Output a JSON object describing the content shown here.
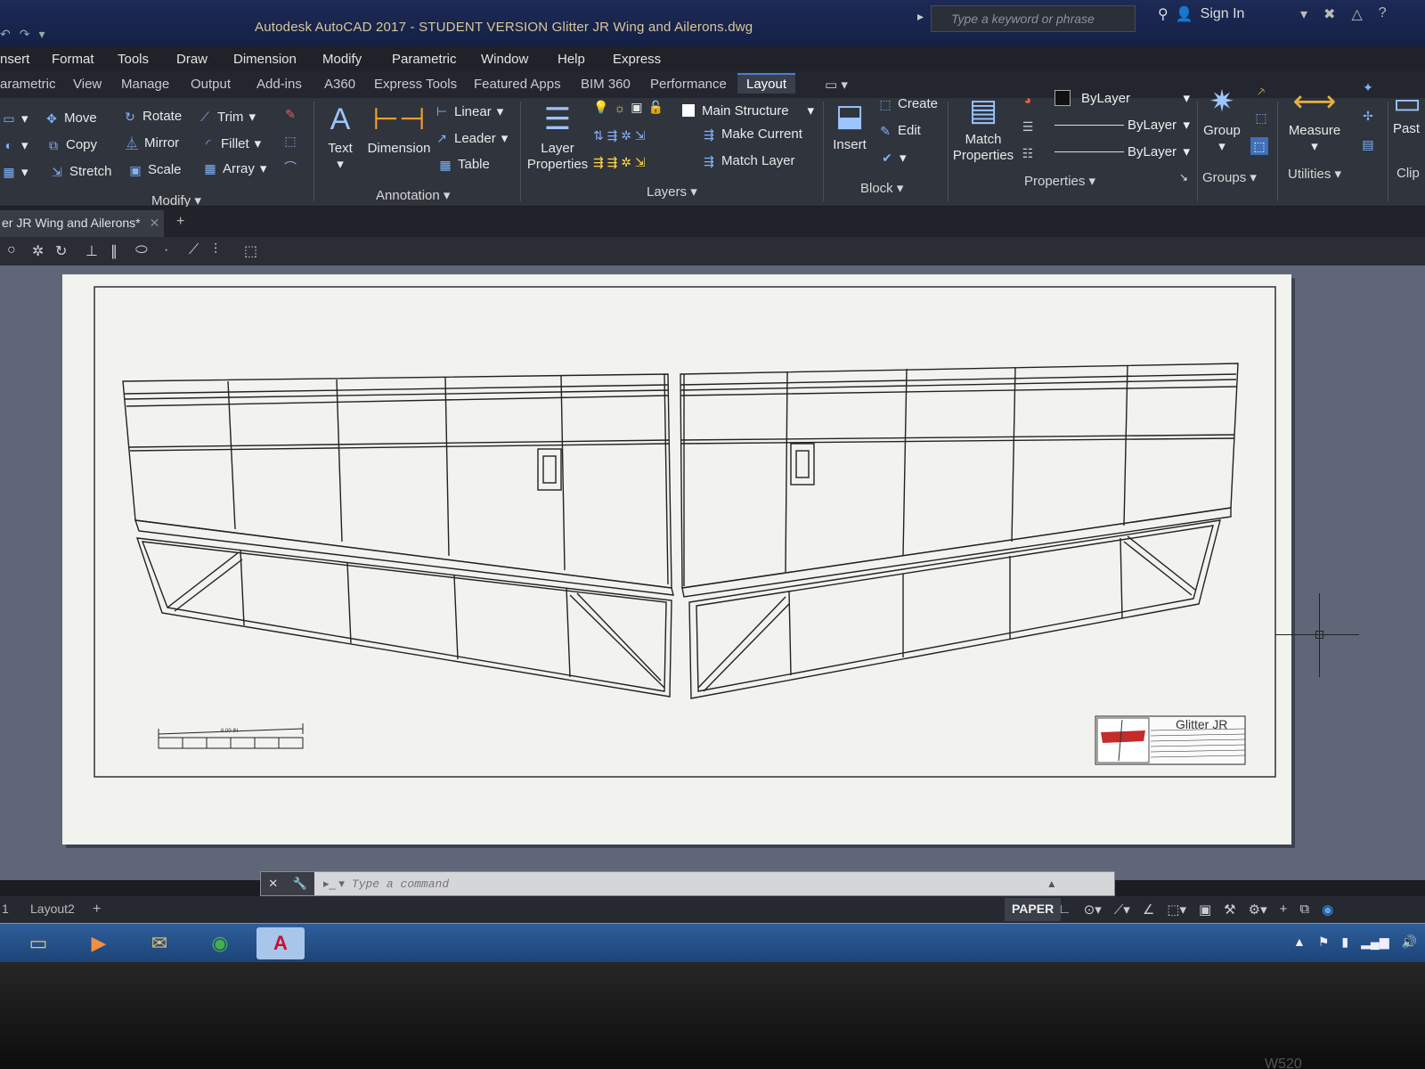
{
  "window": {
    "title": "Autodesk AutoCAD 2017 - STUDENT VERSION    Glitter JR Wing and Ailerons.dwg",
    "search_placeholder": "Type a keyword or phrase",
    "sign_in": "Sign In"
  },
  "menubar": [
    "nsert",
    "Format",
    "Tools",
    "Draw",
    "Dimension",
    "Modify",
    "Parametric",
    "Window",
    "Help",
    "Express"
  ],
  "ribbon_tabs": [
    "arametric",
    "View",
    "Manage",
    "Output",
    "Add-ins",
    "A360",
    "Express Tools",
    "Featured Apps",
    "BIM 360",
    "Performance",
    "Layout"
  ],
  "ribbon": {
    "modify": {
      "label": "Modify",
      "move": "Move",
      "rotate": "Rotate",
      "trim": "Trim",
      "copy": "Copy",
      "mirror": "Mirror",
      "fillet": "Fillet",
      "stretch": "Stretch",
      "scale": "Scale",
      "array": "Array"
    },
    "annotation": {
      "label": "Annotation",
      "text": "Text",
      "dimension": "Dimension",
      "linear": "Linear",
      "leader": "Leader",
      "table": "Table"
    },
    "layers": {
      "label": "Layers",
      "layer_properties_1": "Layer",
      "layer_properties_2": "Properties",
      "current_layer": "Main Structure",
      "make_current": "Make Current",
      "match_layer": "Match Layer"
    },
    "block": {
      "label": "Block",
      "insert": "Insert",
      "create": "Create",
      "edit": "Edit"
    },
    "properties": {
      "label": "Properties",
      "match_1": "Match",
      "match_2": "Properties",
      "color": "ByLayer",
      "linetype": "ByLayer",
      "lineweight": "ByLayer"
    },
    "groups": {
      "label": "Groups",
      "group": "Group"
    },
    "utilities": {
      "label": "Utilities",
      "measure": "Measure"
    },
    "clipboard": {
      "label": "Clip",
      "paste": "Past"
    }
  },
  "file_tab": "er JR Wing and Ailerons*",
  "drawing": {
    "scale_bar_label": "6.00 IN",
    "title_block_name": "Glitter JR"
  },
  "command_line": {
    "placeholder": "Type a command"
  },
  "layout_tabs": [
    "1",
    "Layout2"
  ],
  "status": {
    "paper": "PAPER"
  },
  "bezel_text": "W520"
}
